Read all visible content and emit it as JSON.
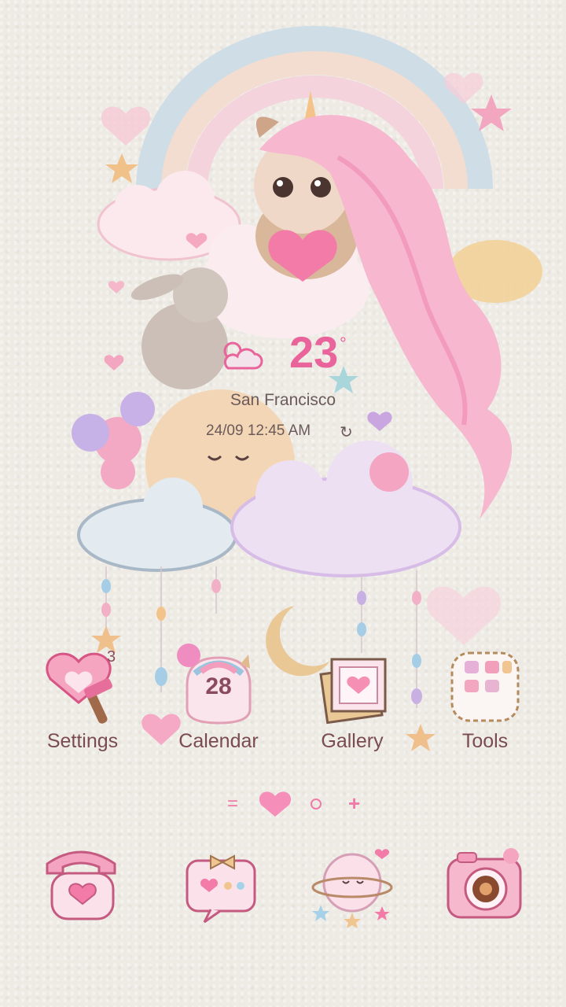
{
  "weather": {
    "temperature": "23",
    "unit": "°",
    "icon": "partly-cloudy-icon",
    "city": "San Francisco",
    "datetime": "24/09 12:45 AM",
    "refresh_icon": "refresh-icon"
  },
  "apps": [
    {
      "label": "Settings",
      "icon": "settings-icon",
      "badge": "3"
    },
    {
      "label": "Calendar",
      "icon": "calendar-icon",
      "date": "28"
    },
    {
      "label": "Gallery",
      "icon": "gallery-icon"
    },
    {
      "label": "Tools",
      "icon": "tools-folder-icon"
    }
  ],
  "page_indicator": {
    "items": [
      "menu-icon",
      "heart-icon",
      "page-dot-icon",
      "add-page-icon"
    ],
    "current": "heart-icon"
  },
  "dock": [
    {
      "icon": "phone-icon"
    },
    {
      "icon": "messages-icon"
    },
    {
      "icon": "browser-icon"
    },
    {
      "icon": "camera-icon"
    }
  ],
  "colors": {
    "accent": "#e8649a",
    "text": "#6b5a5a",
    "label": "#7a4b50",
    "background": "#eeebe5"
  }
}
